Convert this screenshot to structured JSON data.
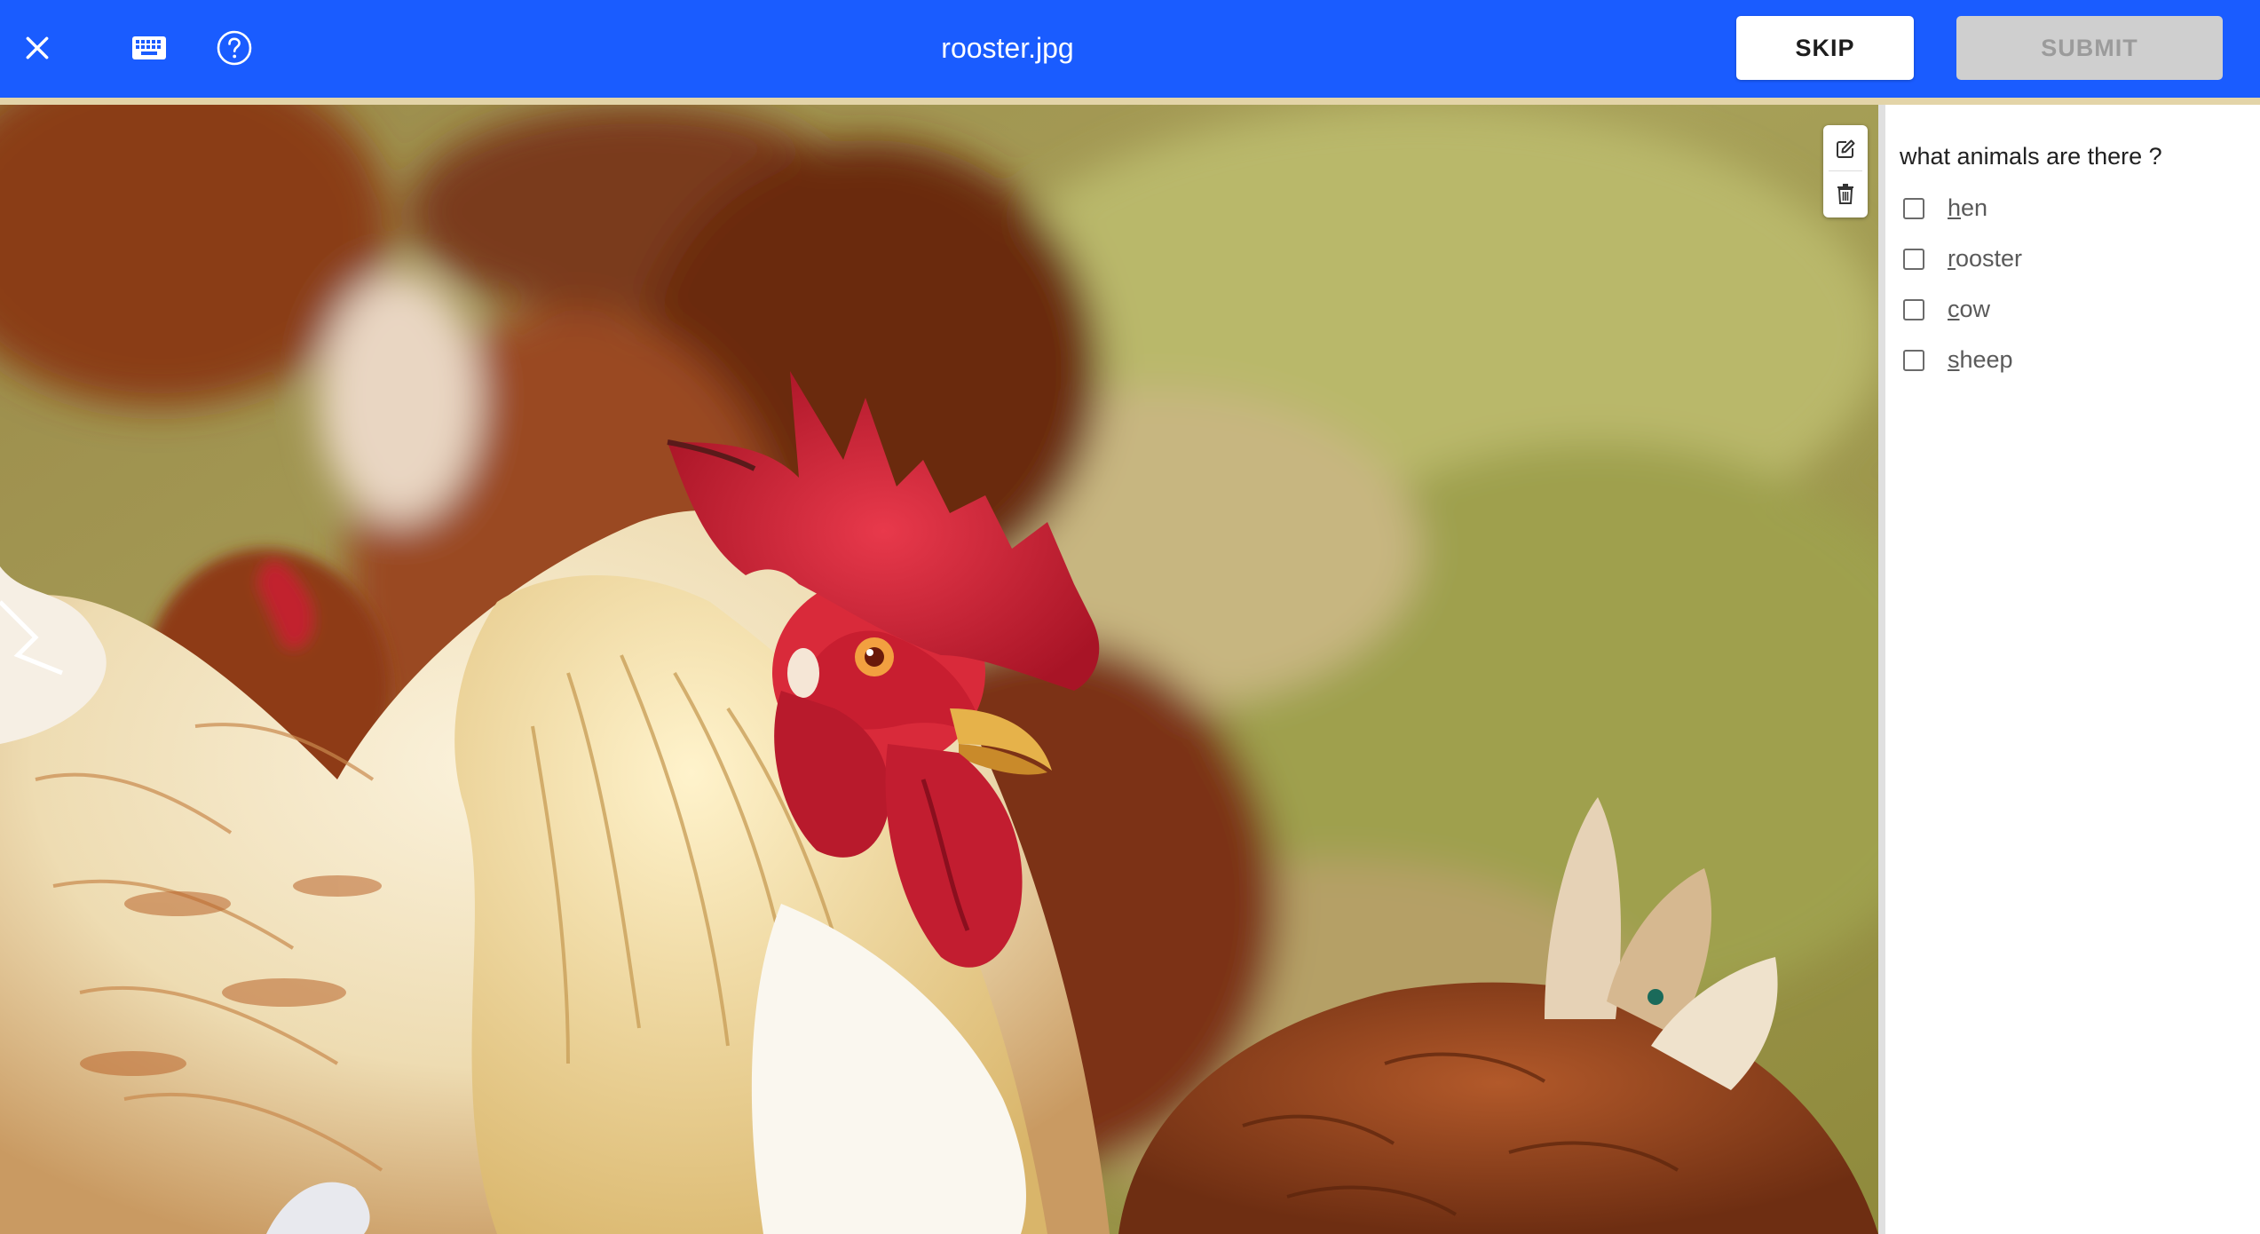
{
  "topbar": {
    "file_name": "rooster.jpg",
    "skip_label": "SKIP",
    "submit_label": "SUBMIT",
    "background_color": "#1a5cff",
    "icons": [
      "close-icon",
      "keyboard-icon",
      "help-icon"
    ]
  },
  "image": {
    "subject": "rooster-photo",
    "tools": [
      "edit-icon",
      "delete-icon"
    ]
  },
  "panel": {
    "question": "what animals are there ?",
    "options": [
      {
        "hotkey": "h",
        "rest": "en",
        "checked": false
      },
      {
        "hotkey": "r",
        "rest": "ooster",
        "checked": false
      },
      {
        "hotkey": "c",
        "rest": "ow",
        "checked": false
      },
      {
        "hotkey": "s",
        "rest": "heep",
        "checked": false
      }
    ]
  }
}
